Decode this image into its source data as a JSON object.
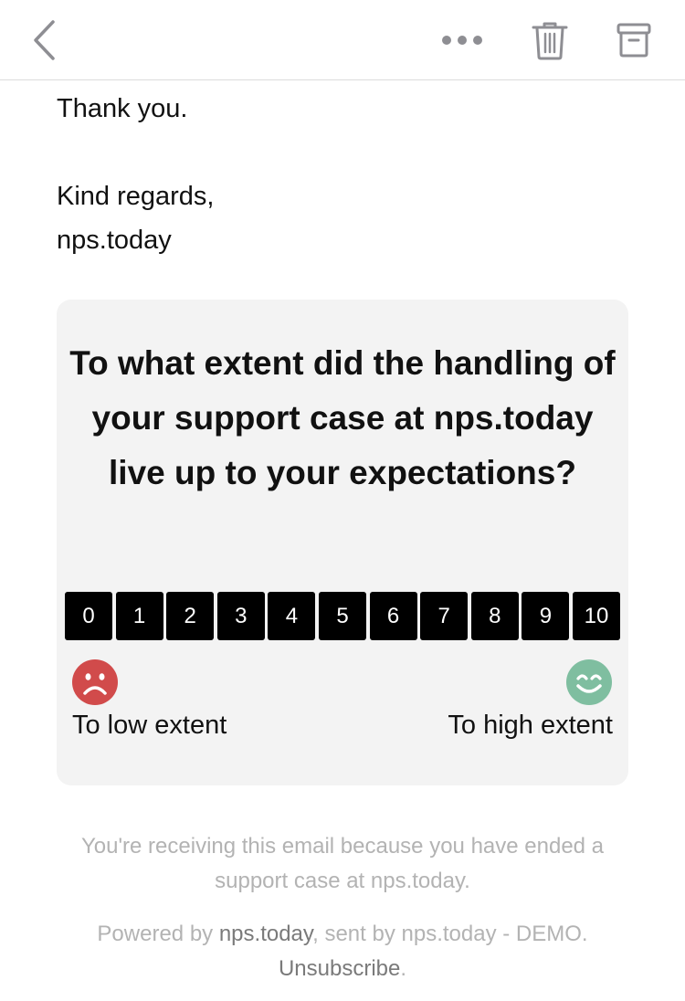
{
  "email": {
    "body_lines": [
      "Thank you.",
      "Kind regards,",
      "nps.today"
    ]
  },
  "survey": {
    "question": "To what extent did the handling of your support case at nps.today live up to your expectations?",
    "scale": [
      "0",
      "1",
      "2",
      "3",
      "4",
      "5",
      "6",
      "7",
      "8",
      "9",
      "10"
    ],
    "low_label": "To low extent",
    "high_label": "To high extent",
    "low_face_color": "#d14b4b",
    "high_face_color": "#7fbea0"
  },
  "footer": {
    "line1": "You're receiving this email because you have ended a support case at nps.today.",
    "powered_prefix": "Powered by ",
    "powered_link": "nps.today",
    "powered_suffix": ", sent by nps.today - DEMO.",
    "unsubscribe": "Unsubscribe",
    "unsubscribe_suffix": "."
  },
  "toolbar": {
    "icons": [
      "back-chevron-icon",
      "more-icon",
      "trash-icon",
      "archive-icon"
    ]
  }
}
